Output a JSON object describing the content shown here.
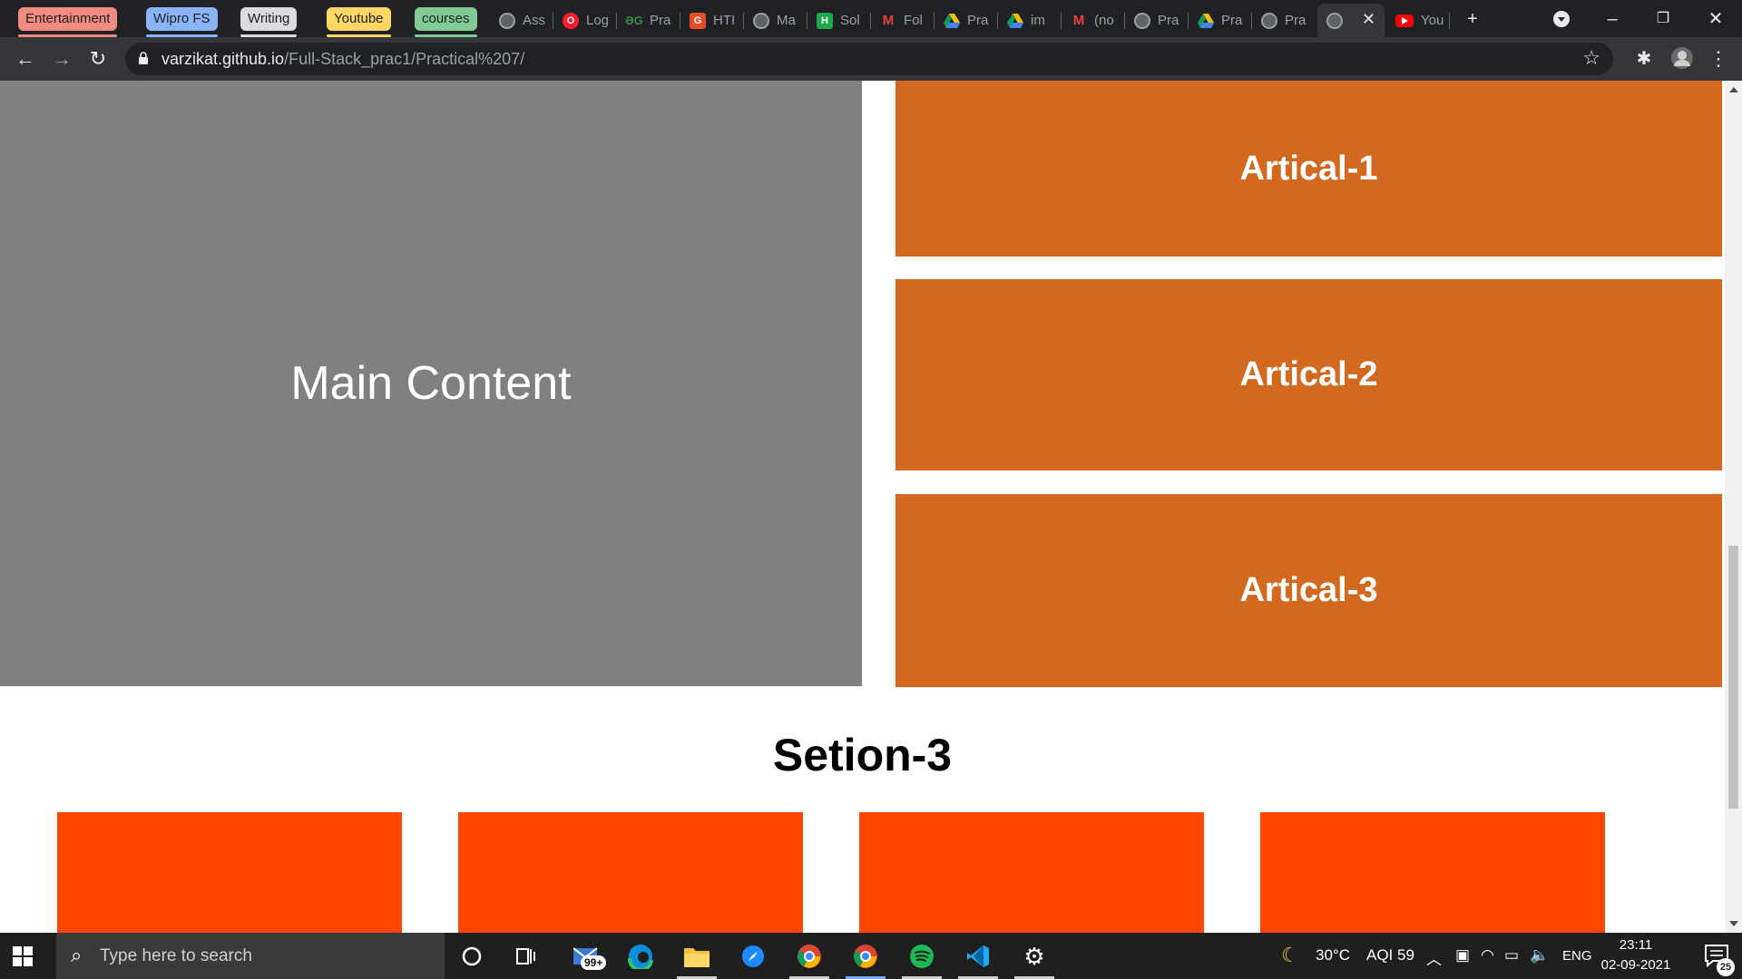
{
  "browser": {
    "tab_groups": [
      {
        "label": "Entertainment",
        "color": "#f28b82"
      },
      {
        "label": "Wipro FS",
        "color": "#8ab4f8"
      },
      {
        "label": "Writing",
        "color": "#dadce0"
      },
      {
        "label": "Youtube",
        "color": "#fdd663"
      },
      {
        "label": "courses",
        "color": "#81c995"
      }
    ],
    "tabs": [
      {
        "title": "Ass",
        "icon": "globe-icon"
      },
      {
        "title": "Log",
        "icon": "opera-icon"
      },
      {
        "title": "Pra",
        "icon": "geeksforgeeks-icon"
      },
      {
        "title": "HTI",
        "icon": "html-icon"
      },
      {
        "title": "Ma",
        "icon": "globe-icon"
      },
      {
        "title": "Sol",
        "icon": "hackerrank-icon"
      },
      {
        "title": "Fol",
        "icon": "gmail-icon"
      },
      {
        "title": "Pra",
        "icon": "google-drive-icon"
      },
      {
        "title": "im",
        "icon": "google-drive-icon"
      },
      {
        "title": "(no",
        "icon": "gmail-icon"
      },
      {
        "title": "Pra",
        "icon": "globe-icon"
      },
      {
        "title": "Pra",
        "icon": "google-drive-icon"
      },
      {
        "title": "Pra",
        "icon": "globe-icon"
      },
      {
        "title": "",
        "icon": "globe-icon"
      },
      {
        "title": "You",
        "icon": "youtube-icon"
      }
    ],
    "url_host": "varzikat.github.io",
    "url_path": "/Full-Stack_prac1/Practical%207/"
  },
  "page": {
    "main_content": "Main Content",
    "articles": [
      "Artical-1",
      "Artical-2",
      "Artical-3"
    ],
    "section_title": "Setion-3",
    "colors": {
      "main": "#808080",
      "article": "#d2691e",
      "box": "#ff4500"
    }
  },
  "taskbar": {
    "search_placeholder": "Type here to search",
    "mail_badge": "99+",
    "weather": "30°C",
    "aqi": "AQI 59",
    "language": "ENG",
    "time": "23:11",
    "date": "02-09-2021",
    "notification_count": "25"
  }
}
